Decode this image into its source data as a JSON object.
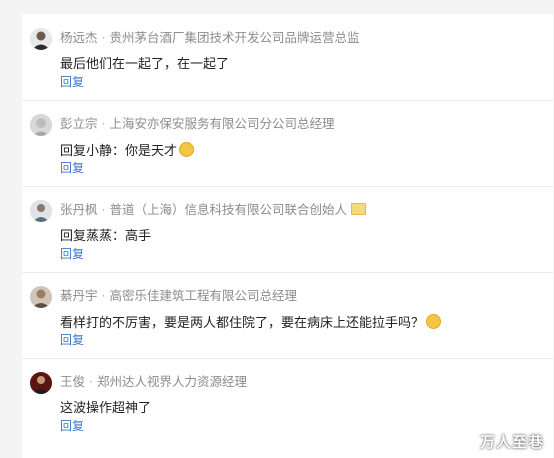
{
  "comments": [
    {
      "author": "杨远杰",
      "title": "贵州茅台酒厂集团技术开发公司品牌运营总监",
      "text": "最后他们在一起了，在一起了",
      "reply_label": "回复",
      "avatar_color": "#3a3a3a"
    },
    {
      "author": "彭立宗",
      "title": "上海安亦保安服务有限公司分公司总经理",
      "text": "回复小静：你是天才",
      "emoji": "smile-emoji",
      "reply_label": "回复",
      "avatar_color": "#c9c9c9"
    },
    {
      "author": "张丹枫",
      "title": "普道（上海）信息科技有限公司联合创始人",
      "badge": "envelope-badge",
      "text": "回复蒸蒸：高手",
      "reply_label": "回复",
      "avatar_color": "#9aa3ad"
    },
    {
      "author": "綦丹宇",
      "title": "高密乐佳建筑工程有限公司总经理",
      "text": "看样打的不厉害，要是两人都住院了，要在病床上还能拉手吗？",
      "emoji": "laugh-emoji",
      "reply_label": "回复",
      "avatar_color": "#8a7a66"
    },
    {
      "author": "王俊",
      "title": "郑州达人视界人力资源经理",
      "text": "这波操作超神了",
      "reply_label": "回复",
      "avatar_color": "#7a1e1e"
    }
  ],
  "separator": "·",
  "watermark": "万人至巷",
  "colors": {
    "link": "#3c76c9",
    "meta": "#8c8c8c",
    "text": "#222222"
  }
}
